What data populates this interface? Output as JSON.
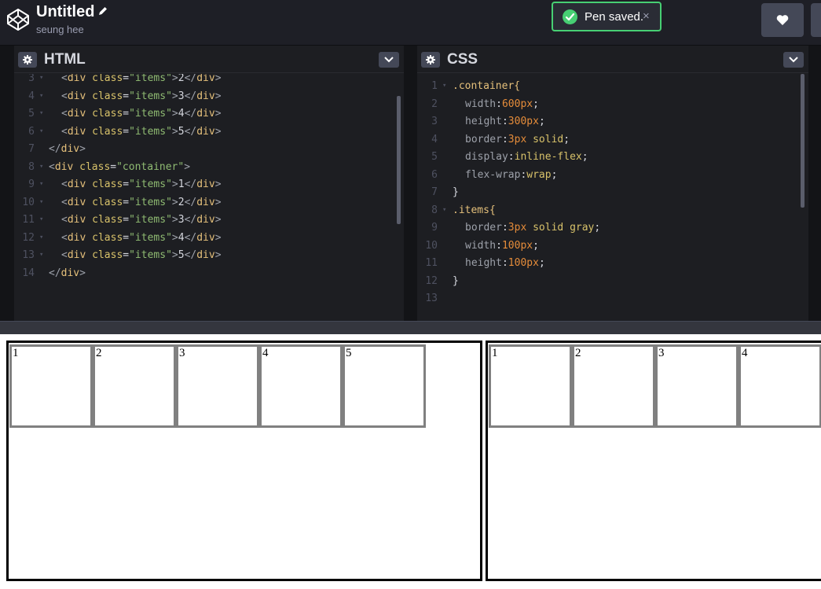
{
  "header": {
    "title": "Untitled",
    "author": "seung hee",
    "toast": "Pen saved.",
    "toast_close": "×"
  },
  "editors": {
    "html_label": "HTML",
    "css_label": "CSS",
    "html_lines": [
      {
        "n": "3",
        "fold": "▾",
        "indent": 1,
        "open": "div",
        "attr": "class",
        "val": "items",
        "text": "2",
        "close": "div"
      },
      {
        "n": "4",
        "fold": "▾",
        "indent": 1,
        "open": "div",
        "attr": "class",
        "val": "items",
        "text": "3",
        "close": "div"
      },
      {
        "n": "5",
        "fold": "▾",
        "indent": 1,
        "open": "div",
        "attr": "class",
        "val": "items",
        "text": "4",
        "close": "div"
      },
      {
        "n": "6",
        "fold": "▾",
        "indent": 1,
        "open": "div",
        "attr": "class",
        "val": "items",
        "text": "5",
        "close": "div"
      },
      {
        "n": "7",
        "fold": "",
        "indent": 0,
        "closeOnly": "div"
      },
      {
        "n": "8",
        "fold": "▾",
        "indent": 0,
        "open": "div",
        "attr": "class",
        "val": "container",
        "openOnly": true
      },
      {
        "n": "9",
        "fold": "▾",
        "indent": 1,
        "open": "div",
        "attr": "class",
        "val": "items",
        "text": "1",
        "close": "div"
      },
      {
        "n": "10",
        "fold": "▾",
        "indent": 1,
        "open": "div",
        "attr": "class",
        "val": "items",
        "text": "2",
        "close": "div"
      },
      {
        "n": "11",
        "fold": "▾",
        "indent": 1,
        "open": "div",
        "attr": "class",
        "val": "items",
        "text": "3",
        "close": "div"
      },
      {
        "n": "12",
        "fold": "▾",
        "indent": 1,
        "open": "div",
        "attr": "class",
        "val": "items",
        "text": "4",
        "close": "div"
      },
      {
        "n": "13",
        "fold": "▾",
        "indent": 1,
        "open": "div",
        "attr": "class",
        "val": "items",
        "text": "5",
        "close": "div"
      },
      {
        "n": "14",
        "fold": "",
        "indent": 0,
        "closeOnly": "div"
      }
    ],
    "css_lines": [
      {
        "n": "1",
        "fold": "▾",
        "selector": ".container{"
      },
      {
        "n": "2",
        "prop": "width",
        "num": "600px",
        "rest": ";"
      },
      {
        "n": "3",
        "prop": "height",
        "num": "300px",
        "rest": ";"
      },
      {
        "n": "4",
        "prop": "border",
        "num": "3px",
        "val": " solid",
        "rest": ";"
      },
      {
        "n": "5",
        "prop": "display",
        "val": "inline-flex",
        "rest": ";"
      },
      {
        "n": "6",
        "prop": "flex-wrap",
        "val": "wrap",
        "rest": ";"
      },
      {
        "n": "7",
        "brace": "}"
      },
      {
        "n": "8",
        "fold": "▾",
        "selector": ".items{"
      },
      {
        "n": "9",
        "prop": "border",
        "num": "3px",
        "val": " solid gray",
        "rest": ";"
      },
      {
        "n": "10",
        "prop": "width",
        "num": "100px",
        "rest": ";"
      },
      {
        "n": "11",
        "prop": "height",
        "num": "100px",
        "rest": ";"
      },
      {
        "n": "12",
        "brace": "}"
      },
      {
        "n": "13"
      }
    ]
  },
  "preview": {
    "containers": [
      {
        "items": [
          "1",
          "2",
          "3",
          "4",
          "5"
        ]
      },
      {
        "items": [
          "1",
          "2",
          "3",
          "4"
        ]
      }
    ]
  }
}
